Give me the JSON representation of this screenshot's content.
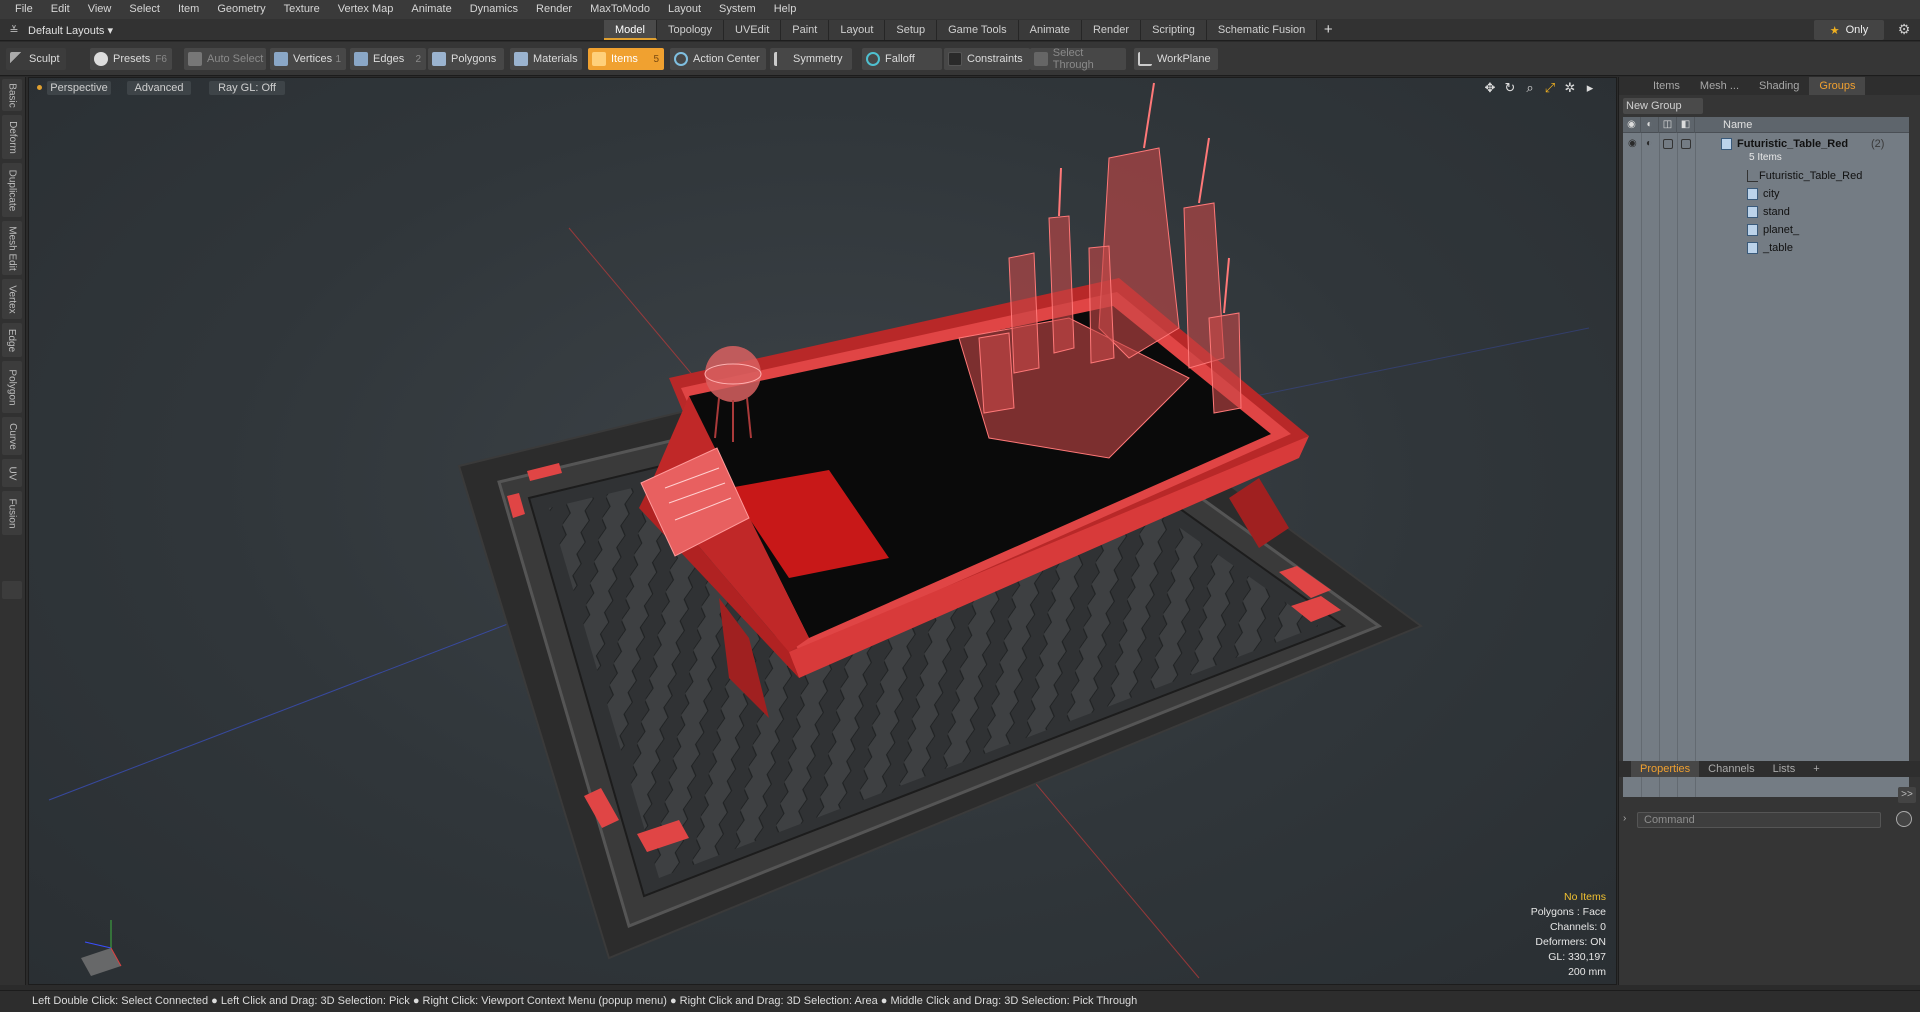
{
  "menubar": [
    "File",
    "Edit",
    "View",
    "Select",
    "Item",
    "Geometry",
    "Texture",
    "Vertex Map",
    "Animate",
    "Dynamics",
    "Render",
    "MaxToModo",
    "Layout",
    "System",
    "Help"
  ],
  "layout_switch": {
    "label": "Default Layouts ▾"
  },
  "layout_tabs": [
    "Model",
    "Topology",
    "UVEdit",
    "Paint",
    "Layout",
    "Setup",
    "Game Tools",
    "Animate",
    "Render",
    "Scripting",
    "Schematic Fusion"
  ],
  "active_layout_tab": "Model",
  "only_button": {
    "label": "Only"
  },
  "toolbar": {
    "sculpt": "Sculpt",
    "presets": "Presets",
    "presets_key": "F6",
    "auto_select": "Auto Select",
    "vertices": "Vertices",
    "vertices_key": "1",
    "edges": "Edges",
    "edges_key": "2",
    "polygons": "Polygons",
    "materials": "Materials",
    "items": "Items",
    "items_key": "5",
    "action_center": "Action Center",
    "symmetry": "Symmetry",
    "falloff": "Falloff",
    "constraints": "Constraints",
    "select_through": "Select Through",
    "workplane": "WorkPlane"
  },
  "left_strip": [
    "Basic",
    "Deform",
    "Duplicate",
    "Mesh Edit",
    "Vertex",
    "Edge",
    "Polygon",
    "Curve",
    "UV",
    "Fusion"
  ],
  "viewport": {
    "perspective": "Perspective",
    "advanced": "Advanced",
    "raygl": "Ray GL: Off",
    "info": {
      "no_items": "No Items",
      "polygons": "Polygons : Face",
      "channels": "Channels: 0",
      "deformers": "Deformers: ON",
      "gl": "GL: 330,197",
      "scale": "200 mm"
    }
  },
  "right_panel": {
    "tabs": [
      "Items",
      "Mesh ...",
      "Shading",
      "Groups"
    ],
    "active_tab": "Groups",
    "new_group": "New Group",
    "column_name": "Name",
    "group": {
      "name": "Futuristic_Table_Red",
      "count": "(2)",
      "items_label": "5 Items"
    },
    "items": [
      "Futuristic_Table_Red",
      "city",
      "stand",
      "planet_",
      "_table"
    ],
    "bottom_tabs": [
      "Properties",
      "Channels",
      "Lists",
      "+"
    ],
    "active_bottom_tab": "Properties",
    "command_placeholder": "Command"
  },
  "statusbar": "Left Double Click: Select Connected ● Left Click and Drag: 3D Selection: Pick ● Right Click: Viewport Context Menu (popup menu) ● Right Click and Drag: 3D Selection: Area ● Middle Click and Drag: 3D Selection: Pick Through",
  "colors": {
    "accent": "#f0a130",
    "model_red": "#e03c3c",
    "viewport_bg": "#343a3e"
  }
}
